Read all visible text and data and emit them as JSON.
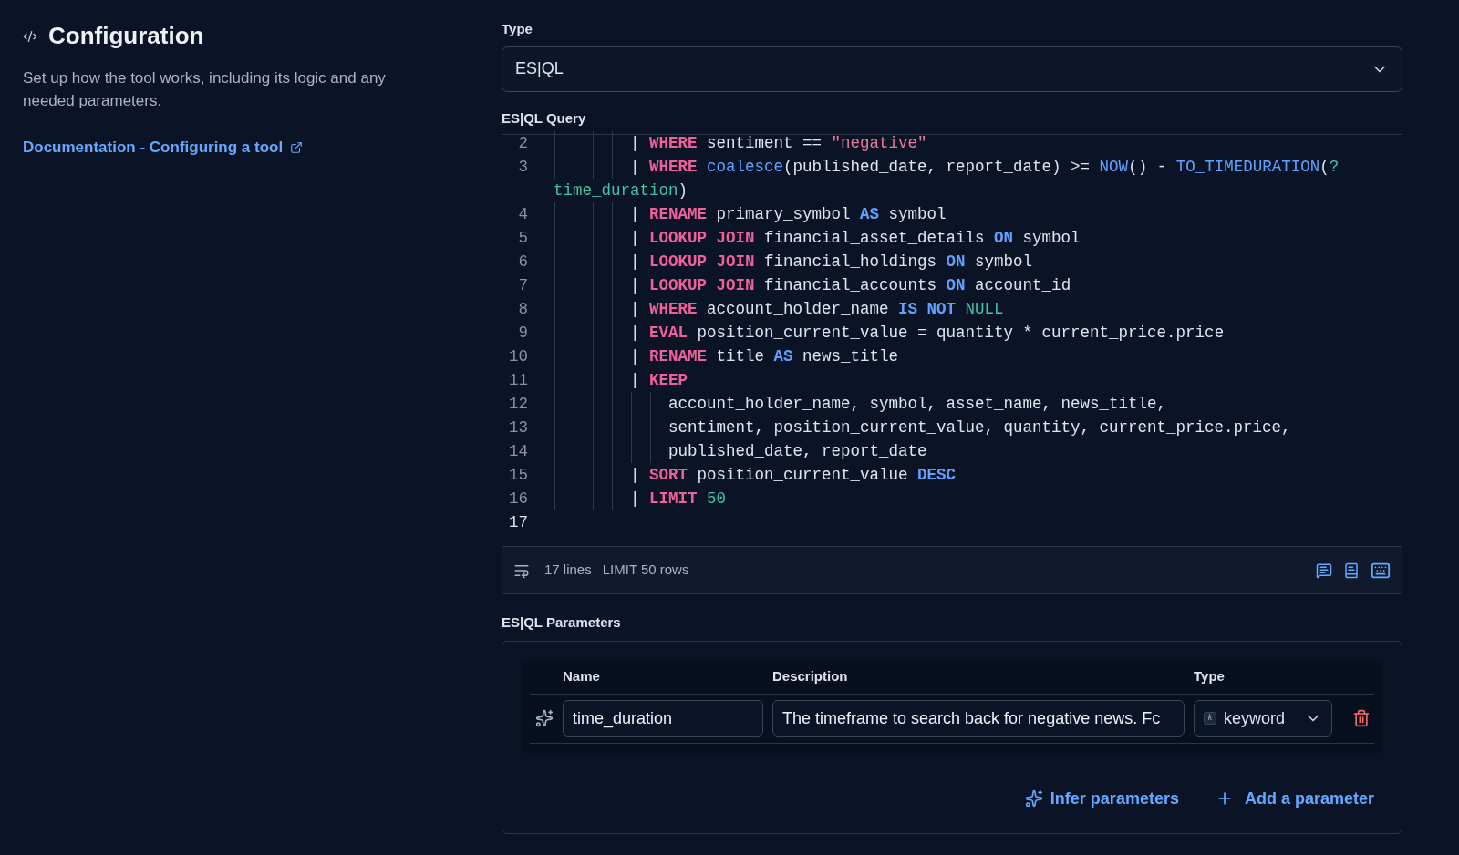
{
  "sidebar": {
    "title": "Configuration",
    "description": "Set up how the tool works, including its logic and any needed parameters.",
    "link": "Documentation - Configuring a tool"
  },
  "type_field": {
    "label": "Type",
    "value": "ES|QL"
  },
  "query": {
    "label": "ES|QL Query",
    "lines": [
      {
        "number": "2",
        "kind": "statement",
        "tokens": [
          {
            "kind": "plain",
            "text": "| "
          },
          {
            "kind": "keyword",
            "text": "WHERE"
          },
          {
            "kind": "plain",
            "text": " sentiment == "
          },
          {
            "kind": "string",
            "text": "\"negative\""
          }
        ]
      },
      {
        "number": "3",
        "kind": "statement",
        "tokens": [
          {
            "kind": "plain",
            "text": "| "
          },
          {
            "kind": "keyword",
            "text": "WHERE "
          },
          {
            "kind": "function",
            "text": "coalesce"
          },
          {
            "kind": "plain",
            "text": "(published_date, report_date) >= "
          },
          {
            "kind": "function",
            "text": "NOW"
          },
          {
            "kind": "plain",
            "text": "() - "
          },
          {
            "kind": "function",
            "text": "TO_TIMEDURATION"
          },
          {
            "kind": "plain",
            "text": "("
          },
          {
            "kind": "literal",
            "text": "?"
          }
        ],
        "continuation": [
          {
            "kind": "literal",
            "text": "time_duration"
          },
          {
            "kind": "plain",
            "text": ")"
          }
        ]
      },
      {
        "number": "4",
        "kind": "statement",
        "tokens": [
          {
            "kind": "plain",
            "text": "| "
          },
          {
            "kind": "keyword",
            "text": "RENAME"
          },
          {
            "kind": "plain",
            "text": " primary_symbol "
          },
          {
            "kind": "operator",
            "text": "AS"
          },
          {
            "kind": "plain",
            "text": " symbol"
          }
        ]
      },
      {
        "number": "5",
        "kind": "statement",
        "tokens": [
          {
            "kind": "plain",
            "text": "| "
          },
          {
            "kind": "keyword",
            "text": "LOOKUP JOIN"
          },
          {
            "kind": "plain",
            "text": " financial_asset_details "
          },
          {
            "kind": "operator",
            "text": "ON"
          },
          {
            "kind": "plain",
            "text": " symbol"
          }
        ]
      },
      {
        "number": "6",
        "kind": "statement",
        "tokens": [
          {
            "kind": "plain",
            "text": "| "
          },
          {
            "kind": "keyword",
            "text": "LOOKUP JOIN"
          },
          {
            "kind": "plain",
            "text": " financial_holdings "
          },
          {
            "kind": "operator",
            "text": "ON"
          },
          {
            "kind": "plain",
            "text": " symbol"
          }
        ]
      },
      {
        "number": "7",
        "kind": "statement",
        "tokens": [
          {
            "kind": "plain",
            "text": "| "
          },
          {
            "kind": "keyword",
            "text": "LOOKUP JOIN"
          },
          {
            "kind": "plain",
            "text": " financial_accounts "
          },
          {
            "kind": "operator",
            "text": "ON"
          },
          {
            "kind": "plain",
            "text": " account_id"
          }
        ]
      },
      {
        "number": "8",
        "kind": "statement",
        "tokens": [
          {
            "kind": "plain",
            "text": "| "
          },
          {
            "kind": "keyword",
            "text": "WHERE"
          },
          {
            "kind": "plain",
            "text": " account_holder_name "
          },
          {
            "kind": "operator",
            "text": "IS NOT "
          },
          {
            "kind": "literal",
            "text": "NULL"
          }
        ]
      },
      {
        "number": "9",
        "kind": "statement",
        "tokens": [
          {
            "kind": "plain",
            "text": "| "
          },
          {
            "kind": "keyword",
            "text": "EVAL"
          },
          {
            "kind": "plain",
            "text": " position_current_value = quantity * current_price.price"
          }
        ]
      },
      {
        "number": "10",
        "kind": "statement",
        "tokens": [
          {
            "kind": "plain",
            "text": "| "
          },
          {
            "kind": "keyword",
            "text": "RENAME"
          },
          {
            "kind": "plain",
            "text": " title "
          },
          {
            "kind": "operator",
            "text": "AS"
          },
          {
            "kind": "plain",
            "text": " news_title"
          }
        ]
      },
      {
        "number": "11",
        "kind": "statement",
        "tokens": [
          {
            "kind": "plain",
            "text": "| "
          },
          {
            "kind": "keyword",
            "text": "KEEP"
          }
        ]
      },
      {
        "number": "12",
        "kind": "list",
        "tokens": [
          {
            "kind": "plain",
            "text": "account_holder_name, symbol, asset_name, news_title,"
          }
        ]
      },
      {
        "number": "13",
        "kind": "list",
        "tokens": [
          {
            "kind": "plain",
            "text": "sentiment, position_current_value, quantity, current_price.price,"
          }
        ]
      },
      {
        "number": "14",
        "kind": "list",
        "tokens": [
          {
            "kind": "plain",
            "text": "published_date, report_date"
          }
        ]
      },
      {
        "number": "15",
        "kind": "statement",
        "tokens": [
          {
            "kind": "plain",
            "text": "| "
          },
          {
            "kind": "keyword",
            "text": "SORT"
          },
          {
            "kind": "plain",
            "text": " position_current_value "
          },
          {
            "kind": "operator",
            "text": "DESC"
          }
        ]
      },
      {
        "number": "16",
        "kind": "statement",
        "tokens": [
          {
            "kind": "plain",
            "text": "| "
          },
          {
            "kind": "keyword",
            "text": "LIMIT "
          },
          {
            "kind": "literal",
            "text": "50"
          }
        ]
      },
      {
        "number": "17",
        "kind": "empty"
      }
    ],
    "footer": {
      "line_count": "17 lines",
      "limit": "LIMIT 50 rows"
    }
  },
  "parameters": {
    "label": "ES|QL Parameters",
    "columns": [
      "Name",
      "Description",
      "Type"
    ],
    "rows": [
      {
        "name": "time_duration",
        "description": "The timeframe to search back for negative news. Fc",
        "type_badge": "k",
        "type": "keyword"
      }
    ],
    "actions": [
      "Infer parameters",
      "Add a parameter"
    ]
  }
}
